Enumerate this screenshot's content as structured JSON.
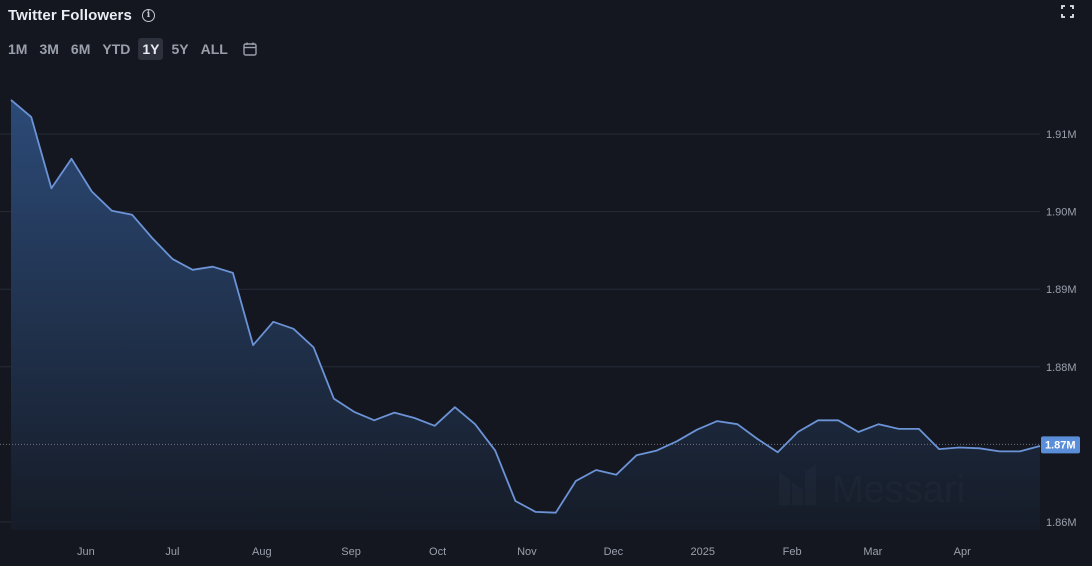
{
  "header": {
    "title": "Twitter Followers",
    "info_icon": "info-icon",
    "expand_icon": "expand-icon"
  },
  "ranges": {
    "items": [
      "1M",
      "3M",
      "6M",
      "YTD",
      "1Y",
      "5Y",
      "ALL"
    ],
    "active": "1Y",
    "calendar_icon": "calendar-icon"
  },
  "watermark": "Messari",
  "chart_data": {
    "type": "area",
    "title": "Twitter Followers",
    "xlabel": "",
    "ylabel": "",
    "x_ticks": [
      "Jun",
      "Jul",
      "Aug",
      "Sep",
      "Oct",
      "Nov",
      "Dec",
      "2025",
      "Feb",
      "Mar",
      "Apr"
    ],
    "y_ticks": [
      "1.86M",
      "1.87M",
      "1.88M",
      "1.89M",
      "1.90M",
      "1.91M"
    ],
    "ylim": [
      1.86,
      1.915
    ],
    "last_value_label": "1.87M",
    "last_value": 1.87,
    "grid": true,
    "series": [
      {
        "points": [
          [
            "2024-05-06",
            1.9144
          ],
          [
            "2024-05-13",
            1.9122
          ],
          [
            "2024-05-20",
            1.903
          ],
          [
            "2024-05-27",
            1.9068
          ],
          [
            "2024-06-03",
            1.9026
          ],
          [
            "2024-06-10",
            1.9001
          ],
          [
            "2024-06-17",
            1.8996
          ],
          [
            "2024-06-24",
            1.8966
          ],
          [
            "2024-07-01",
            1.8939
          ],
          [
            "2024-07-08",
            1.8925
          ],
          [
            "2024-07-15",
            1.8929
          ],
          [
            "2024-07-22",
            1.8921
          ],
          [
            "2024-07-29",
            1.8828
          ],
          [
            "2024-08-05",
            1.8858
          ],
          [
            "2024-08-12",
            1.8849
          ],
          [
            "2024-08-19",
            1.8825
          ],
          [
            "2024-08-26",
            1.8759
          ],
          [
            "2024-09-02",
            1.8742
          ],
          [
            "2024-09-09",
            1.8731
          ],
          [
            "2024-09-16",
            1.8741
          ],
          [
            "2024-09-23",
            1.8734
          ],
          [
            "2024-09-30",
            1.8724
          ],
          [
            "2024-10-07",
            1.8748
          ],
          [
            "2024-10-14",
            1.8726
          ],
          [
            "2024-10-21",
            1.8692
          ],
          [
            "2024-10-28",
            1.8627
          ],
          [
            "2024-11-04",
            1.8613
          ],
          [
            "2024-11-11",
            1.8612
          ],
          [
            "2024-11-18",
            1.8653
          ],
          [
            "2024-11-25",
            1.8667
          ],
          [
            "2024-12-02",
            1.8661
          ],
          [
            "2024-12-09",
            1.8686
          ],
          [
            "2024-12-16",
            1.8692
          ],
          [
            "2024-12-23",
            1.8704
          ],
          [
            "2024-12-30",
            1.8719
          ],
          [
            "2025-01-06",
            1.873
          ],
          [
            "2025-01-13",
            1.8726
          ],
          [
            "2025-01-20",
            1.8707
          ],
          [
            "2025-01-27",
            1.869
          ],
          [
            "2025-02-03",
            1.8716
          ],
          [
            "2025-02-10",
            1.8731
          ],
          [
            "2025-02-17",
            1.8731
          ],
          [
            "2025-02-24",
            1.8716
          ],
          [
            "2025-03-03",
            1.8726
          ],
          [
            "2025-03-10",
            1.872
          ],
          [
            "2025-03-17",
            1.872
          ],
          [
            "2025-03-24",
            1.8694
          ],
          [
            "2025-03-31",
            1.8696
          ],
          [
            "2025-04-07",
            1.8695
          ],
          [
            "2025-04-14",
            1.8691
          ],
          [
            "2025-04-21",
            1.8691
          ],
          [
            "2025-04-28",
            1.8698
          ]
        ]
      }
    ]
  },
  "colors": {
    "background": "#141720",
    "line": "#6b93d6",
    "area_top": "#2d4d7c",
    "area_bottom": "#161c28",
    "grid": "#262b36",
    "axis_text": "#9aa0ab",
    "badge": "#5b8ed8"
  }
}
